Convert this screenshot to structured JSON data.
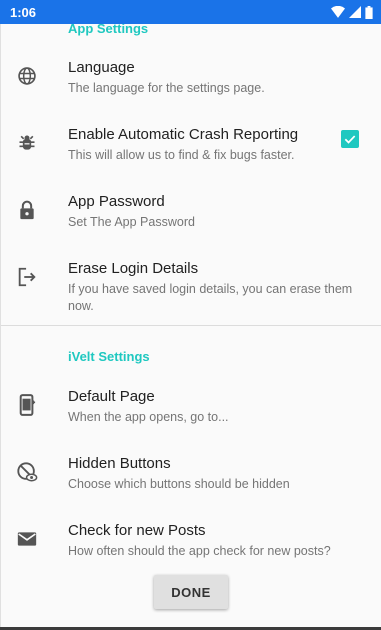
{
  "status_bar": {
    "time": "1:06",
    "icons": [
      "wifi-icon",
      "signal-icon",
      "battery-icon"
    ],
    "color": "#1a73e8"
  },
  "accent_color": "#1fc8c0",
  "sections": {
    "app": {
      "header": "App Settings"
    },
    "ivelt": {
      "header": "iVelt Settings"
    }
  },
  "prefs": {
    "language": {
      "icon": "globe-icon",
      "title": "Language",
      "summary": "The language for the settings page."
    },
    "crash": {
      "icon": "bug-icon",
      "title": "Enable Automatic Crash Reporting",
      "summary": "This will allow us to find & fix bugs faster.",
      "checked": true
    },
    "password": {
      "icon": "lock-icon",
      "title": "App Password",
      "summary": "Set The App Password"
    },
    "erase": {
      "icon": "logout-icon",
      "title": "Erase Login Details",
      "summary": "If you have saved login details, you can erase them now."
    },
    "default_page": {
      "icon": "phone-add-icon",
      "title": "Default Page",
      "summary": "When the app opens, go to..."
    },
    "hidden_buttons": {
      "icon": "visibility-off-icon",
      "title": "Hidden Buttons",
      "summary": "Choose which buttons should be hidden"
    },
    "check_posts": {
      "icon": "mail-icon",
      "title": "Check for new Posts",
      "summary": "How often should the app check for new posts?"
    }
  },
  "done_label": "DONE"
}
